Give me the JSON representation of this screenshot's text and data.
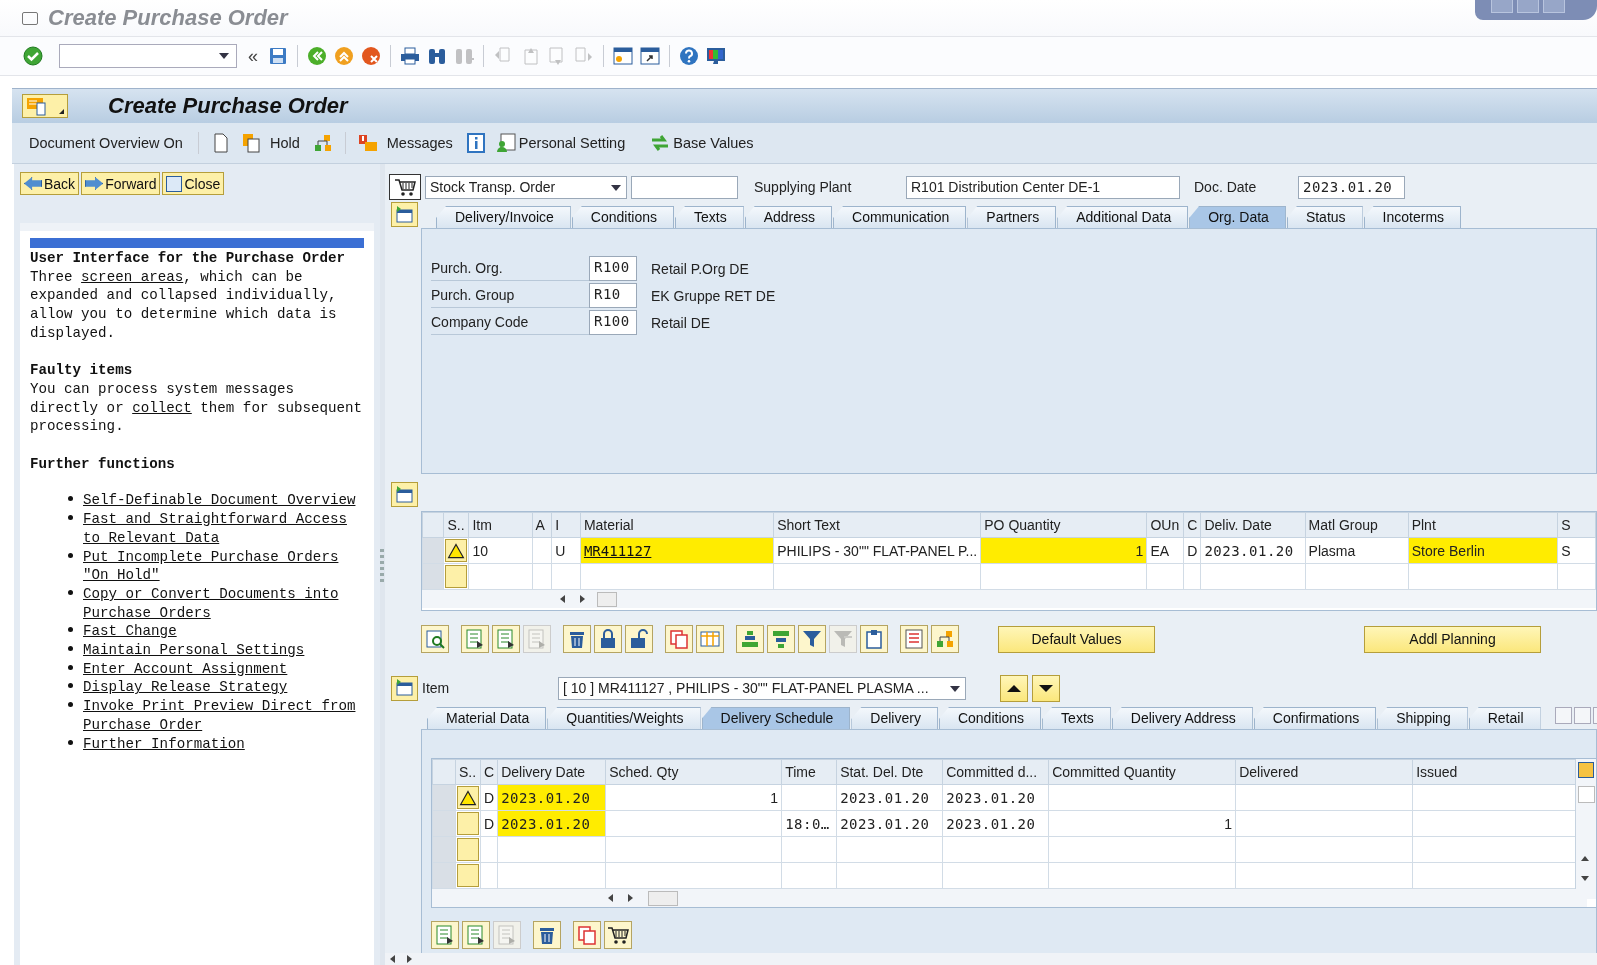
{
  "title_bar": {
    "title": "Create Purchase Order"
  },
  "system_toolbar": {
    "collapse": "«",
    "buttons": [
      {
        "disabled": false
      },
      {
        "disabled": false
      },
      {
        "disabled": false
      },
      {
        "disabled": false
      },
      {
        "disabled": false
      },
      {
        "disabled": false
      },
      {
        "disabled": false
      },
      {
        "disabled": true
      },
      {
        "disabled": true
      },
      {
        "disabled": true
      },
      {
        "disabled": true
      },
      {
        "disabled": true
      },
      {
        "disabled": false
      },
      {
        "disabled": false
      },
      {
        "disabled": false
      },
      {
        "disabled": false
      }
    ]
  },
  "app_header": {
    "title": "Create Purchase Order"
  },
  "app_toolbar": {
    "items": [
      {
        "kind": "text",
        "label": "Document Overview On"
      },
      {
        "kind": "icon"
      },
      {
        "kind": "icon"
      },
      {
        "kind": "text",
        "label": "Hold"
      },
      {
        "kind": "icon"
      },
      {
        "kind": "icon"
      },
      {
        "kind": "text",
        "label": "Messages"
      },
      {
        "kind": "icon"
      },
      {
        "kind": "icon-text",
        "label": "Personal Setting"
      },
      {
        "kind": "icon-text",
        "label": "Base Values"
      }
    ]
  },
  "help_pane": {
    "buttons": [
      {
        "label": "Back"
      },
      {
        "label": "Forward"
      },
      {
        "label": "Close"
      }
    ],
    "sections": [
      {
        "heading": "User Interface for the Purchase Order",
        "parts": [
          {
            "text": "Three ",
            "link": false
          },
          {
            "text": "screen areas",
            "link": true
          },
          {
            "text": ", which can be expanded and collapsed individually, allow you to determine which data is displayed.",
            "link": false
          }
        ]
      },
      {
        "heading": "Faulty items",
        "parts": [
          {
            "text": "You can process system messages directly or ",
            "link": false
          },
          {
            "text": "collect",
            "link": true
          },
          {
            "text": " them for subsequent processing.",
            "link": false
          }
        ]
      },
      {
        "heading": "Further functions",
        "links": [
          "Self-Definable Document Overview",
          "Fast and Straightforward Access to Relevant Data",
          "Put Incomplete Purchase Orders \"On Hold\"",
          "Copy or Convert Documents into Purchase Orders",
          "Fast Change",
          "Maintain Personal Settings",
          "Enter Account Assignment",
          "Display Release Strategy",
          "Invoke Print Preview Direct from Purchase Order",
          "Further Information"
        ]
      }
    ]
  },
  "header": {
    "doc_type": "Stock Transp. Order",
    "supplying_plant_label": "Supplying Plant",
    "supplying_plant": "R101 Distribution Center DE-1",
    "doc_date_label": "Doc. Date",
    "doc_date": "2023.01.20",
    "tabs": [
      {
        "label": "Delivery/Invoice",
        "selected": false
      },
      {
        "label": "Conditions",
        "selected": false
      },
      {
        "label": "Texts",
        "selected": false
      },
      {
        "label": "Address",
        "selected": false
      },
      {
        "label": "Communication",
        "selected": false
      },
      {
        "label": "Partners",
        "selected": false
      },
      {
        "label": "Additional Data",
        "selected": false
      },
      {
        "label": "Org. Data",
        "selected": true
      },
      {
        "label": "Status",
        "selected": false
      },
      {
        "label": "Incoterms",
        "selected": false
      }
    ],
    "fields": [
      {
        "label": "Purch. Org.",
        "value": "R100",
        "description": "Retail P.Org DE"
      },
      {
        "label": "Purch. Group",
        "value": "R10",
        "description": "EK Gruppe RET  DE"
      },
      {
        "label": "Company Code",
        "value": "R100",
        "description": "Retail DE"
      }
    ]
  },
  "items_table": {
    "columns": [
      "S..",
      "Itm",
      "A",
      "I",
      "Material",
      "Short Text",
      "PO Quantity",
      "OUn",
      "C",
      "Deliv. Date",
      "Matl Group",
      "Plnt",
      "S"
    ],
    "rows": [
      {
        "warning": true,
        "cells": [
          {
            "text": "10",
            "highlighted": false
          },
          {
            "highlighted": false
          },
          {
            "text": "U",
            "highlighted": false
          },
          {
            "text": "MR411127",
            "highlighted": true,
            "link": true
          },
          {
            "text": "PHILIPS - 30\"\" FLAT-PANEL P...",
            "highlighted": false
          },
          {
            "text": "1",
            "highlighted": true
          },
          {
            "text": "EA",
            "highlighted": false
          },
          {
            "text": "D",
            "highlighted": false
          },
          {
            "text": "2023.01.20",
            "highlighted": false
          },
          {
            "text": "Plasma",
            "highlighted": false
          },
          {
            "text": "Store Berlin",
            "highlighted": true
          },
          {
            "text": "S",
            "highlighted": false
          }
        ]
      },
      {
        "warning": false
      }
    ],
    "toolbar": [
      {
        "disabled": false
      },
      {
        "disabled": false
      },
      {
        "disabled": false
      },
      {
        "disabled": true
      },
      {
        "disabled": false
      },
      {
        "disabled": false
      },
      {
        "disabled": false
      },
      {
        "disabled": false
      },
      {
        "disabled": false
      },
      {
        "disabled": false
      },
      {
        "disabled": false
      },
      {
        "disabled": false
      },
      {
        "disabled": true
      },
      {
        "disabled": false
      },
      {
        "disabled": false
      },
      {
        "disabled": false
      }
    ],
    "buttons": [
      {
        "label": "Default Values"
      },
      {
        "label": "Addl Planning"
      }
    ]
  },
  "item_detail": {
    "label": "Item",
    "selector": "[ 10 ] MR411127 , PHILIPS - 30\"\" FLAT-PANEL PLASMA ...",
    "tabs": [
      {
        "label": "Material Data",
        "selected": false
      },
      {
        "label": "Quantities/Weights",
        "selected": false
      },
      {
        "label": "Delivery Schedule",
        "selected": true
      },
      {
        "label": "Delivery",
        "selected": false
      },
      {
        "label": "Conditions",
        "selected": false
      },
      {
        "label": "Texts",
        "selected": false
      },
      {
        "label": "Delivery Address",
        "selected": false
      },
      {
        "label": "Confirmations",
        "selected": false
      },
      {
        "label": "Shipping",
        "selected": false
      },
      {
        "label": "Retail",
        "selected": false
      }
    ],
    "schedule": {
      "columns": [
        "S..",
        "C",
        "Delivery Date",
        "Sched. Qty",
        "Time",
        "Stat. Del. Dte",
        "Committed d...",
        "Committed Quantity",
        "Delivered",
        "Issued"
      ],
      "rows": [
        {
          "warning": true,
          "cells": [
            {
              "text": "D",
              "highlighted": false
            },
            {
              "text": "2023.01.20",
              "highlighted": true
            },
            {
              "text": "1",
              "highlighted": false
            },
            {
              "highlighted": false
            },
            {
              "text": "2023.01.20",
              "highlighted": false
            },
            {
              "text": "2023.01.20",
              "highlighted": false
            },
            {
              "highlighted": false
            },
            {
              "highlighted": false
            },
            {
              "highlighted": false
            }
          ]
        },
        {
          "warning": false,
          "cells": [
            {
              "text": "D",
              "highlighted": false
            },
            {
              "text": "2023.01.20",
              "highlighted": true
            },
            {
              "highlighted": false
            },
            {
              "text": "18:0…",
              "highlighted": false
            },
            {
              "text": "2023.01.20",
              "highlighted": false
            },
            {
              "text": "2023.01.20",
              "highlighted": false
            },
            {
              "text": "1",
              "highlighted": false
            },
            {
              "highlighted": false
            },
            {
              "highlighted": false
            }
          ]
        },
        {
          "warning": false
        },
        {
          "warning": false
        }
      ],
      "toolbar": [
        {
          "disabled": false
        },
        {
          "disabled": false
        },
        {
          "disabled": true
        },
        {
          "disabled": false
        },
        {
          "disabled": false
        },
        {
          "disabled": false
        }
      ]
    }
  }
}
